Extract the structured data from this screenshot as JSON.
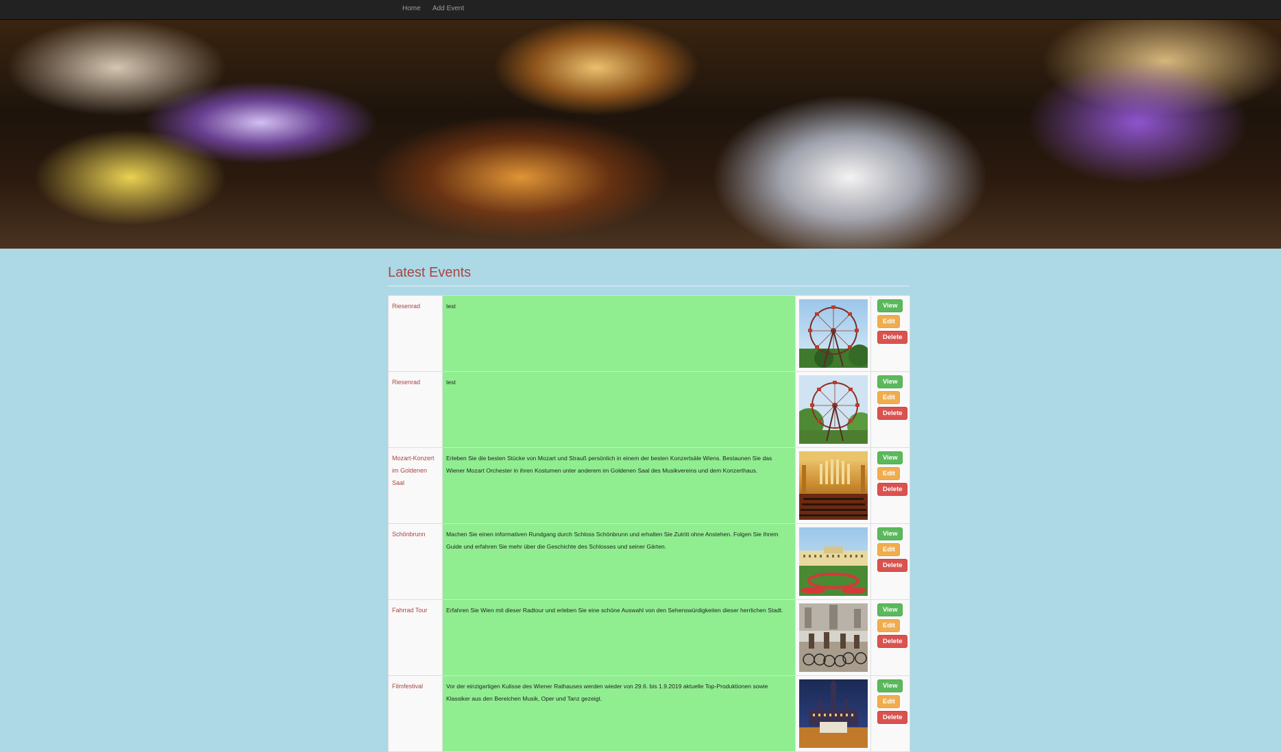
{
  "nav": {
    "items": [
      {
        "label": "Home"
      },
      {
        "label": "Add Event"
      }
    ]
  },
  "colors": {
    "page_bg": "#add8e6",
    "navbar_bg": "#222222",
    "title": "#a94442",
    "desc_bg": "#90ee90",
    "view": "#5cb85c",
    "edit": "#f0ad4e",
    "delete": "#d9534f"
  },
  "main": {
    "title": "Latest Events",
    "buttons": {
      "view": "View",
      "edit": "Edit",
      "delete": "Delete"
    },
    "events": [
      {
        "name": "Riesenrad",
        "description": "test",
        "image": "ferris-wheel-photo"
      },
      {
        "name": "Riesenrad",
        "description": "test",
        "image": "ferris-wheel-photo"
      },
      {
        "name": "Mozart-Konzert im Goldenen Saal",
        "description": "Erleben Sie die besten Stücke von Mozart und Strauß persönlich in einem der besten Konzertsäle Wiens. Bestaunen Sie das Wiener Mozart Orchester in ihren Kostumen unter anderem im Goldenen Saal des Musikvereins und dem Konzerthaus.",
        "image": "concert-hall-photo"
      },
      {
        "name": "Schönbrunn",
        "description": "Machen Sie einen informativen Rundgang durch Schloss Schönbrunn und erhalten Sie Zutritt ohne Anstehen. Folgen Sie Ihrem Guide und erfahren Sie mehr über die Geschichte des Schlosses und seiner Gärten.",
        "image": "palace-garden-photo"
      },
      {
        "name": "Fahrrad Tour",
        "description": "Erfahren Sie Wien mit dieser Radtour und erleben Sie eine schöne Auswahl von den Sehenswürdigkeiten dieser herrlichen Stadt.",
        "image": "bicycle-tour-photo"
      },
      {
        "name": "Filmfestival",
        "description": "Vor der einzigartigen Kulisse des Wiener Rathauses werden wieder von 29.6. bis 1.9.2019 aktuelle Top-Produktionen sowie Klassiker aus den Bereichen Musik, Oper und Tanz gezeigt.",
        "image": "city-hall-night-photo"
      }
    ]
  }
}
